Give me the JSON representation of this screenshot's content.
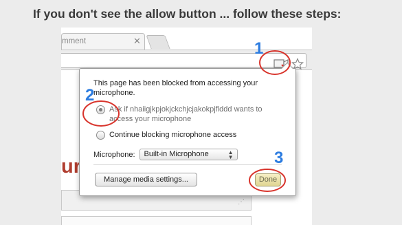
{
  "heading": "If you don't see the allow button ... follow these steps:",
  "browser": {
    "tab": {
      "title": "mment",
      "close_glyph": "✕"
    },
    "omnibox": {
      "icons": [
        "camera-blocked-icon",
        "bookmark-star-icon"
      ]
    }
  },
  "background_page": {
    "partial_heading": "ur r",
    "scroll_grip": "⋰"
  },
  "popup": {
    "message": "This page has been blocked from accessing your microphone.",
    "options": [
      {
        "label": "Ask if nhaiigjkpjokjckchjcjakokpjflddd wants to access your microphone",
        "checked": true
      },
      {
        "label": "Continue blocking microphone access",
        "checked": false
      }
    ],
    "microphone_label": "Microphone:",
    "microphone_selected": "Built-in Microphone",
    "manage_button": "Manage media settings...",
    "done_button": "Done"
  },
  "annotations": {
    "step1": "1",
    "step2": "2",
    "step3": "3",
    "circle_color": "#d8342c",
    "number_color": "#2c7ce0"
  }
}
